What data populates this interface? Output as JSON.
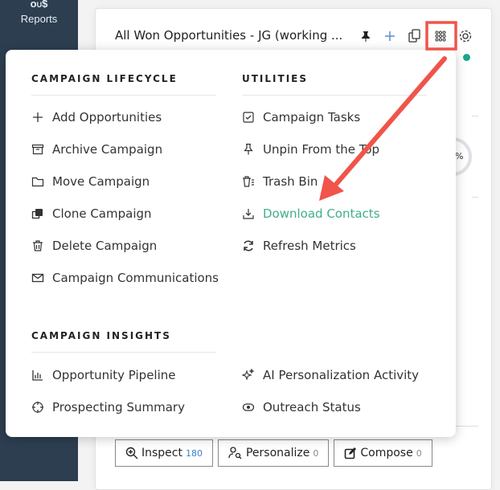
{
  "sidebar": {
    "reports_label": "Reports"
  },
  "card": {
    "title": "All Won Opportunities - JG (working ...",
    "percent_symbol": "%"
  },
  "actions": [
    {
      "label": "Inspect",
      "count": "180"
    },
    {
      "label": "Personalize",
      "count": "0"
    },
    {
      "label": "Compose",
      "count": "0"
    }
  ],
  "menu": {
    "lifecycle": {
      "heading": "CAMPAIGN LIFECYCLE",
      "items": [
        {
          "label": "Add Opportunities",
          "icon": "plus-icon"
        },
        {
          "label": "Archive Campaign",
          "icon": "archive-icon"
        },
        {
          "label": "Move Campaign",
          "icon": "folder-icon"
        },
        {
          "label": "Clone Campaign",
          "icon": "clone-icon"
        },
        {
          "label": "Delete Campaign",
          "icon": "trash-icon"
        },
        {
          "label": "Campaign Communications",
          "icon": "envelope-icon"
        }
      ]
    },
    "utilities": {
      "heading": "UTILITIES",
      "items": [
        {
          "label": "Campaign Tasks",
          "icon": "checkbox-icon"
        },
        {
          "label": "Unpin From the Top",
          "icon": "pin-icon"
        },
        {
          "label": "Trash Bin",
          "icon": "trash-bin-icon"
        },
        {
          "label": "Download Contacts",
          "icon": "download-icon",
          "highlight_color": "#3fae8e"
        },
        {
          "label": "Refresh Metrics",
          "icon": "refresh-icon"
        }
      ]
    },
    "insights": {
      "heading": "CAMPAIGN INSIGHTS",
      "items": [
        {
          "label": "Opportunity Pipeline",
          "icon": "bar-chart-icon"
        },
        {
          "label": "Prospecting Summary",
          "icon": "crosshair-icon"
        },
        {
          "label": "AI Personalization Activity",
          "icon": "sparkle-icon"
        },
        {
          "label": "Outreach Status",
          "icon": "outreach-icon"
        }
      ]
    }
  },
  "annotation": {
    "color": "#f0544a"
  }
}
